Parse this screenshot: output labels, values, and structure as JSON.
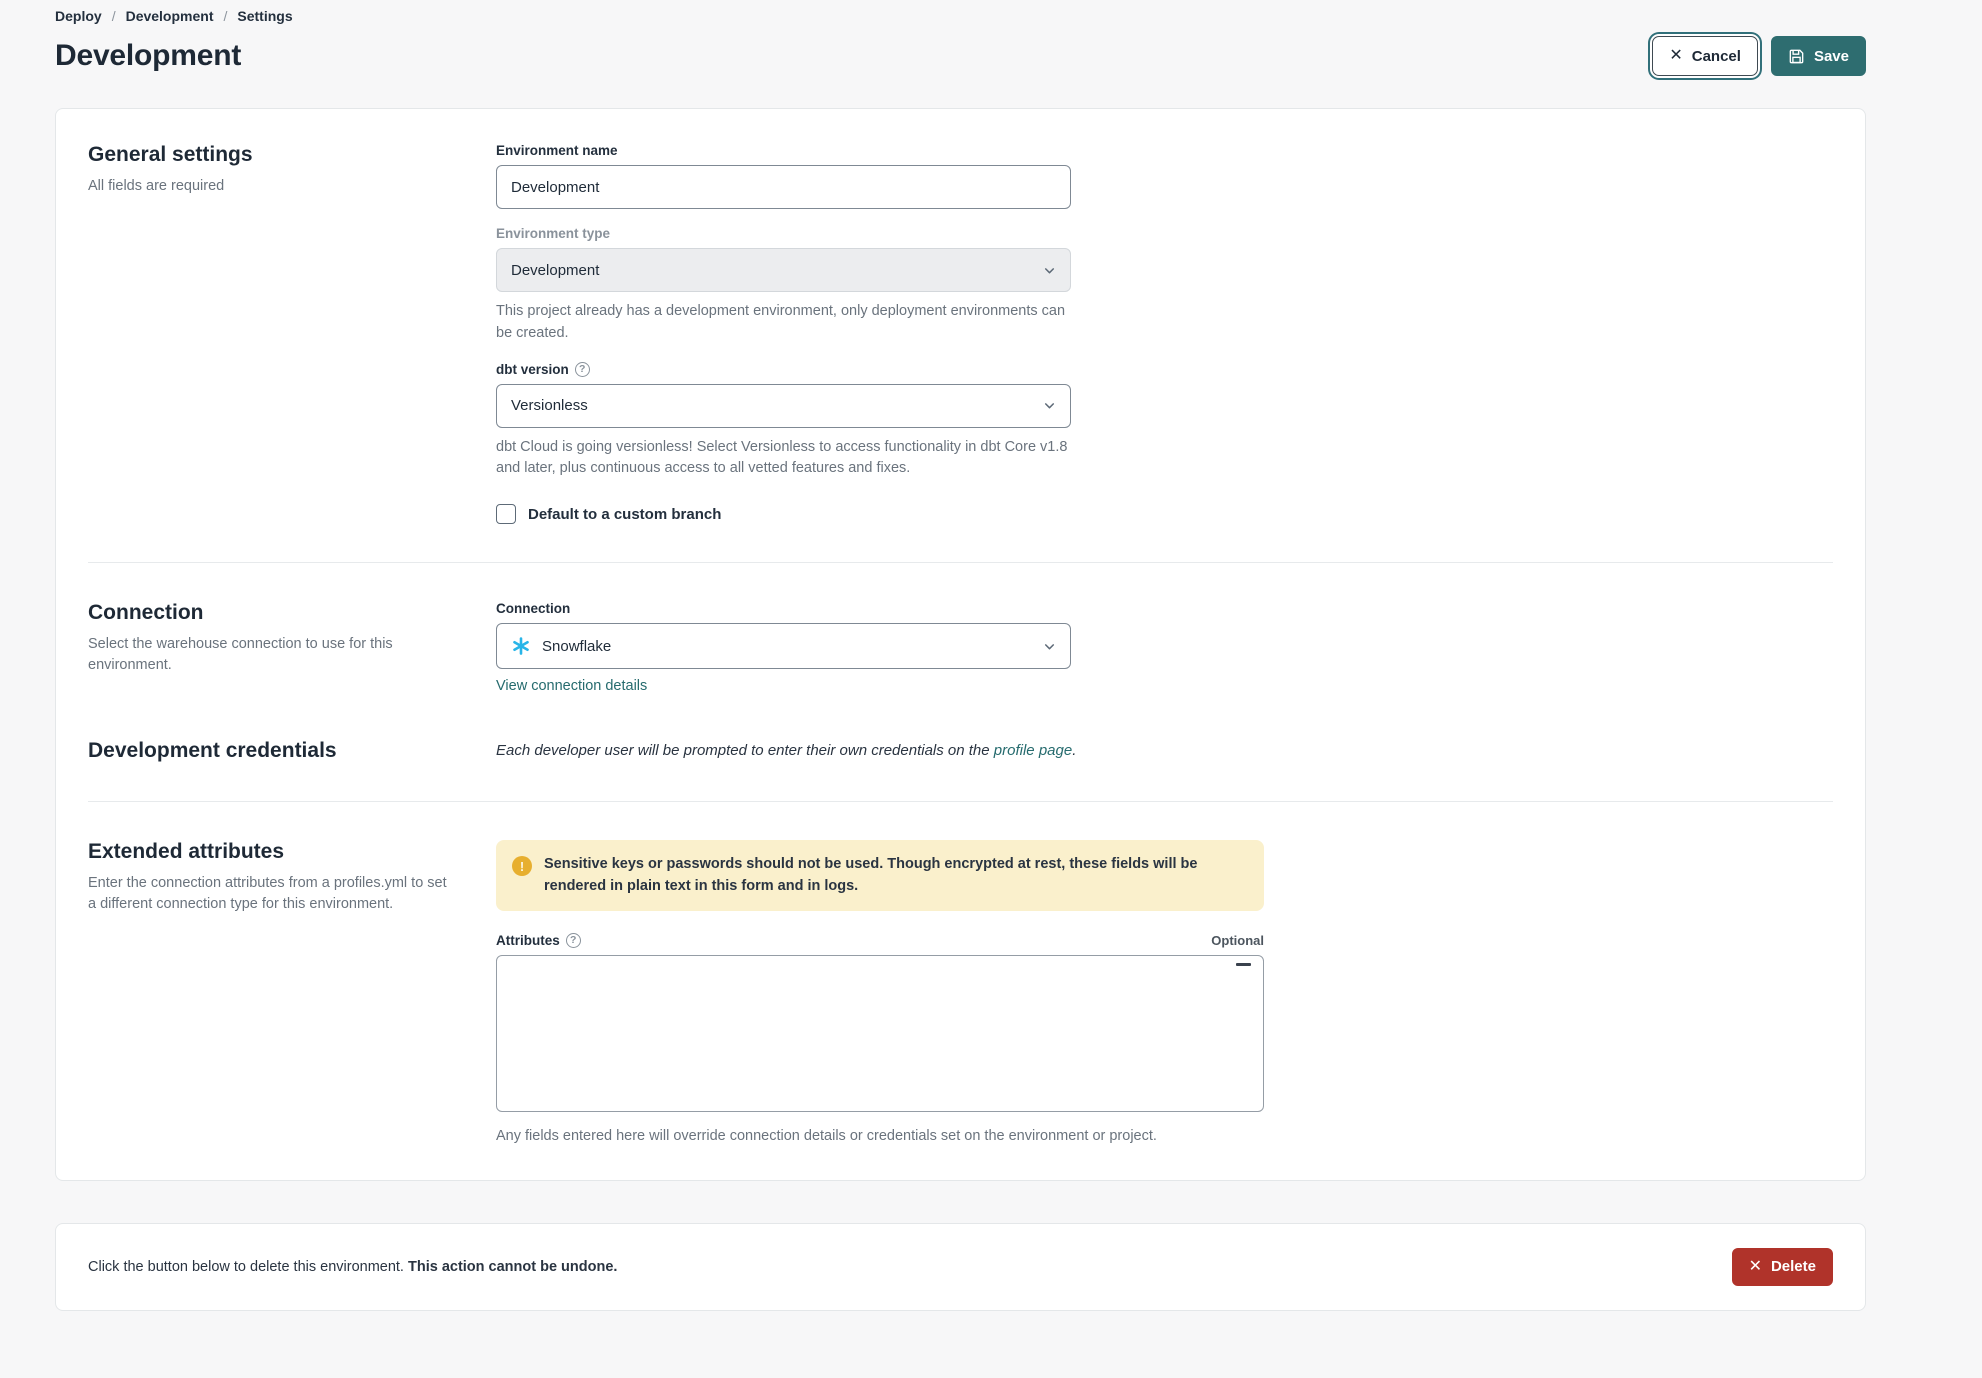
{
  "colors": {
    "teal": "#2e6d70",
    "link_teal": "#266b6e",
    "danger_red": "#b0332a",
    "warning_bg": "#faf0cc",
    "warning_icon": "#e7af2f",
    "snowflake_blue": "#29b5e8"
  },
  "breadcrumb": {
    "separator": "/",
    "items": [
      {
        "label": "Deploy"
      },
      {
        "label": "Development"
      },
      {
        "label": "Settings"
      }
    ]
  },
  "header": {
    "title": "Development",
    "cancel_label": "Cancel",
    "save_label": "Save"
  },
  "general": {
    "heading": "General settings",
    "subheading": "All fields are required",
    "environment_name": {
      "label": "Environment name",
      "value": "Development"
    },
    "environment_type": {
      "label": "Environment type",
      "value": "Development",
      "helper": "This project already has a development environment, only deployment environments can be created."
    },
    "dbt_version": {
      "label": "dbt version",
      "value": "Versionless",
      "helper": "dbt Cloud is going versionless! Select Versionless to access functionality in dbt Core v1.8 and later, plus continuous access to all vetted features and fixes."
    },
    "custom_branch": {
      "label": "Default to a custom branch",
      "checked": false
    }
  },
  "connection": {
    "heading": "Connection",
    "subheading": "Select the warehouse connection to use for this environment.",
    "field_label": "Connection",
    "value": "Snowflake",
    "link_label": "View connection details"
  },
  "credentials": {
    "heading": "Development credentials",
    "note_prefix": "Each developer user will be prompted to enter their own credentials on the ",
    "note_link": "profile page",
    "note_suffix": "."
  },
  "extended": {
    "heading": "Extended attributes",
    "subheading": "Enter the connection attributes from a profiles.yml to set a different connection type for this environment.",
    "warning": "Sensitive keys or passwords should not be used. Though encrypted at rest, these fields will be rendered in plain text in this form and in logs.",
    "attributes_label": "Attributes",
    "optional_label": "Optional",
    "textarea_value": "",
    "helper": "Any fields entered here will override connection details or credentials set on the environment or project."
  },
  "danger": {
    "text_normal": "Click the button below to delete this environment. ",
    "text_bold": "This action cannot be undone.",
    "delete_label": "Delete"
  }
}
